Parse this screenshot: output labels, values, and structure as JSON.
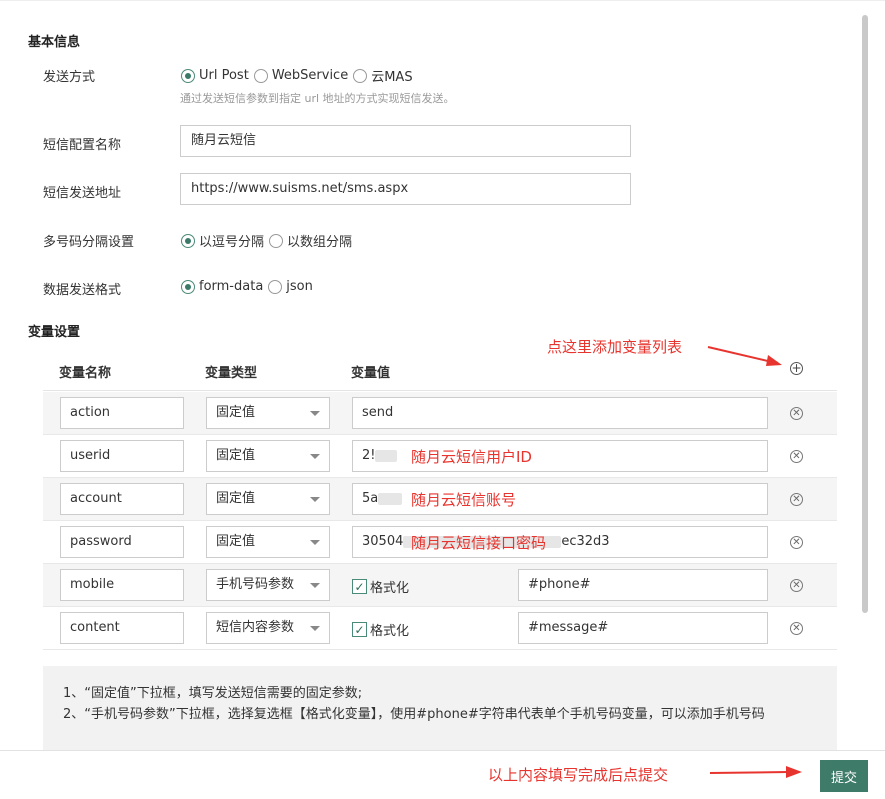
{
  "sections": {
    "basic": "基本信息",
    "vars": "变量设置"
  },
  "send_method": {
    "label": "发送方式",
    "options": [
      "Url Post",
      "WebService",
      "云MAS"
    ],
    "selected": "Url Post",
    "hint": "通过发送短信参数到指定 url 地址的方式实现短信发送。"
  },
  "config_name": {
    "label": "短信配置名称",
    "value": "随月云短信"
  },
  "send_url": {
    "label": "短信发送地址",
    "value": "https://www.suisms.net/sms.aspx"
  },
  "separator": {
    "label": "多号码分隔设置",
    "options": [
      "以逗号分隔",
      "以数组分隔"
    ],
    "selected": "以逗号分隔"
  },
  "data_format": {
    "label": "数据发送格式",
    "options": [
      "form-data",
      "json"
    ],
    "selected": "form-data"
  },
  "var_table": {
    "headers": [
      "变量名称",
      "变量类型",
      "变量值"
    ],
    "add_icon": "plus-circle-icon",
    "remove_icon": "x-circle-icon",
    "rows": [
      {
        "name": "action",
        "type": "固定值",
        "value": "send"
      },
      {
        "name": "userid",
        "type": "固定值",
        "value_prefix": "2!",
        "annotation": "随月云短信用户ID"
      },
      {
        "name": "account",
        "type": "固定值",
        "value_prefix": "5a",
        "annotation": "随月云短信账号"
      },
      {
        "name": "password",
        "type": "固定值",
        "value_prefix": "30504",
        "value_suffix": "ec32d3",
        "annotation": "随月云短信接口密码"
      },
      {
        "name": "mobile",
        "type": "手机号码参数",
        "format_label": "格式化",
        "format_checked": true,
        "value": "#phone#"
      },
      {
        "name": "content",
        "type": "短信内容参数",
        "format_label": "格式化",
        "format_checked": true,
        "value": "#message#"
      }
    ]
  },
  "annotations": {
    "add_list": "点这里添加变量列表",
    "submit": "以上内容填写完成后点提交"
  },
  "notes": [
    "1、“固定值”下拉框，填写发送短信需要的固定参数;",
    "2、“手机号码参数”下拉框，选择复选框【格式化变量】，使用#phone#字符串代表单个手机号码变量，可以添加手机号码"
  ],
  "submit_label": "提交",
  "colors": {
    "accent": "#3e7b69",
    "annotation": "#e8342e"
  }
}
